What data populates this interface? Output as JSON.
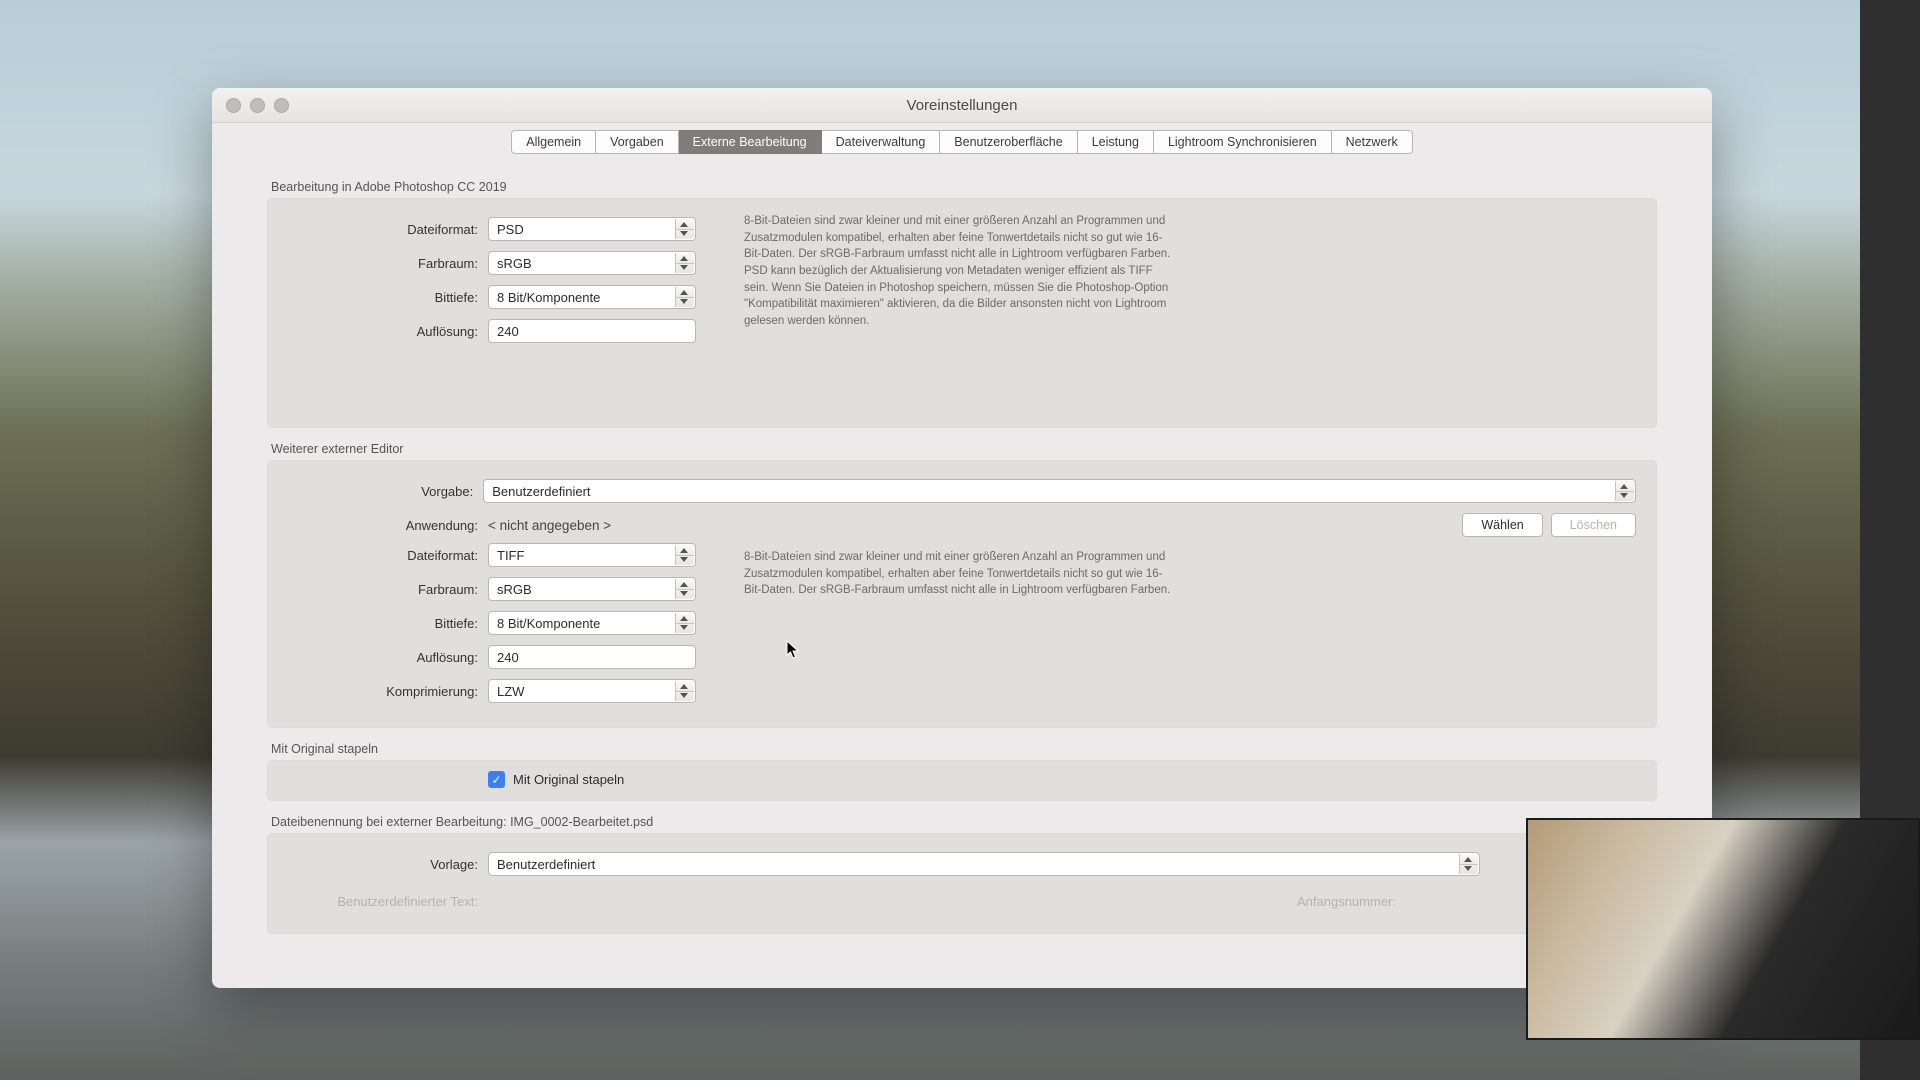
{
  "window": {
    "title": "Voreinstellungen"
  },
  "tabs": [
    {
      "label": "Allgemein"
    },
    {
      "label": "Vorgaben"
    },
    {
      "label": "Externe Bearbeitung",
      "active": true
    },
    {
      "label": "Dateiverwaltung"
    },
    {
      "label": "Benutzeroberfläche"
    },
    {
      "label": "Leistung"
    },
    {
      "label": "Lightroom Synchronisieren"
    },
    {
      "label": "Netzwerk"
    }
  ],
  "section1": {
    "title": "Bearbeitung in Adobe Photoshop CC 2019",
    "labels": {
      "fileformat": "Dateiformat:",
      "colorspace": "Farbraum:",
      "bitdepth": "Bittiefe:",
      "resolution": "Auflösung:"
    },
    "values": {
      "fileformat": "PSD",
      "colorspace": "sRGB",
      "bitdepth": "8 Bit/Komponente",
      "resolution": "240"
    },
    "note": "8-Bit-Dateien sind zwar kleiner und mit einer größeren Anzahl an Programmen und Zusatzmodulen kompatibel, erhalten aber feine Tonwertdetails nicht so gut wie 16-Bit-Daten. Der sRGB-Farbraum umfasst nicht alle in Lightroom verfügbaren Farben. PSD kann bezüglich der Aktualisierung von Metadaten weniger effizient als TIFF sein. Wenn Sie Dateien in Photoshop speichern, müssen Sie die Photoshop-Option \"Kompatibilität maximieren\" aktivieren, da die Bilder ansonsten nicht von Lightroom gelesen werden können."
  },
  "section2": {
    "title": "Weiterer externer Editor",
    "labels": {
      "preset": "Vorgabe:",
      "application": "Anwendung:",
      "fileformat": "Dateiformat:",
      "colorspace": "Farbraum:",
      "bitdepth": "Bittiefe:",
      "resolution": "Auflösung:",
      "compression": "Komprimierung:"
    },
    "values": {
      "preset": "Benutzerdefiniert",
      "application": "< nicht angegeben >",
      "fileformat": "TIFF",
      "colorspace": "sRGB",
      "bitdepth": "8 Bit/Komponente",
      "resolution": "240",
      "compression": "LZW"
    },
    "buttons": {
      "choose": "Wählen",
      "clear": "Löschen"
    },
    "note": "8-Bit-Dateien sind zwar kleiner und mit einer größeren Anzahl an Programmen und Zusatzmodulen kompatibel, erhalten aber feine Tonwertdetails nicht so gut wie 16-Bit-Daten. Der sRGB-Farbraum umfasst nicht alle in Lightroom verfügbaren Farben."
  },
  "section3": {
    "title": "Mit Original stapeln",
    "checkbox_label": "Mit Original stapeln",
    "checked": true
  },
  "section4": {
    "title": "Dateibenennung bei externer Bearbeitung: IMG_0002-Bearbeitet.psd",
    "labels": {
      "template": "Vorlage:",
      "customtext": "Benutzerdefinierter Text:",
      "startnumber": "Anfangsnummer:"
    },
    "values": {
      "template": "Benutzerdefiniert"
    }
  }
}
